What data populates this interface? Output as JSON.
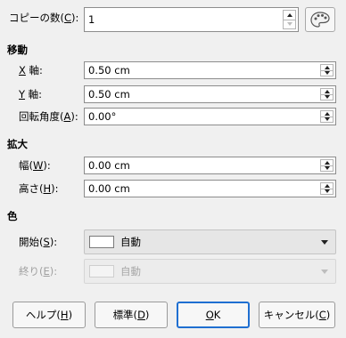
{
  "copies": {
    "label": "コピーの数(",
    "mnemonic": "C",
    "label_end": "):",
    "value": "1",
    "palette_icon": "color-palette-icon"
  },
  "move": {
    "heading": "移動",
    "x": {
      "mnemonic": "X",
      "label_rest": " 軸:",
      "value": "0.50 cm"
    },
    "y": {
      "mnemonic": "Y",
      "label_rest": " 軸:",
      "value": "0.50 cm"
    },
    "angle": {
      "label": "回転角度(",
      "mnemonic": "A",
      "label_end": "):",
      "value": "0.00°"
    }
  },
  "enlarge": {
    "heading": "拡大",
    "width": {
      "label": "幅(",
      "mnemonic": "W",
      "label_end": "):",
      "value": "0.00 cm"
    },
    "height": {
      "label": "高さ(",
      "mnemonic": "H",
      "label_end": "):",
      "value": "0.00 cm"
    }
  },
  "color": {
    "heading": "色",
    "start": {
      "label": "開始(",
      "mnemonic": "S",
      "label_end": "):",
      "value": "自動",
      "swatch": "#ffffff"
    },
    "end": {
      "label": "終り(",
      "mnemonic": "E",
      "label_end": "):",
      "value": "自動",
      "enabled": false
    }
  },
  "buttons": {
    "help": {
      "label": "ヘルプ(",
      "mnemonic": "H",
      "label_end": ")"
    },
    "default": {
      "label": "標準(",
      "mnemonic": "D",
      "label_end": ")"
    },
    "ok": {
      "mnemonic": "O",
      "label_rest": "K"
    },
    "cancel": {
      "label": "キャンセル(",
      "mnemonic": "C",
      "label_end": ")"
    }
  },
  "colors": {
    "accent": "#1f6fd1",
    "background": "#f0f0f0"
  }
}
